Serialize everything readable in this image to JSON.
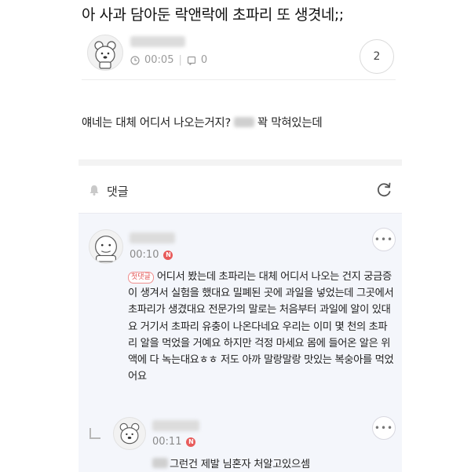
{
  "post": {
    "title": "아 사과 담아둔 락앤락에 초파리 또 생겻네;;",
    "time": "00:05",
    "comment_count": "0",
    "reply_count": "2",
    "body_before": "얘네는 대체 어디서 나오는거지?",
    "body_after": "꽉 막혀있는데"
  },
  "comments_header": {
    "label": "댓글"
  },
  "comments": [
    {
      "time": "00:10",
      "new_badge": "N",
      "tag": "첫댓글",
      "text": "어디서 봤는데 초파리는 대체 어디서 나오는 건지 궁금증이 생겨서 실험을 했대요 밀폐된 곳에 과일을 넣었는데 그곳에서 초파리가 생겼대요 전문가의 말로는 처음부터 과일에 알이 있대요 거기서 초파리 유충이 나온다네요 우리는 이미 몇 천의 초파리 알을 먹었을 거예요 하지만 걱정 마세요 몸에 들어온 알은 위액에 다 녹는대요ㅎㅎ 저도 아까 말랑말랑 맛있는 복숭아를 먹었어요"
    }
  ],
  "reply": {
    "time": "00:11",
    "new_badge": "N",
    "text": "그런건 제발 님혼자 처알고있으셈"
  },
  "icons": {
    "clock": "clock-icon",
    "comment": "comment-icon",
    "bell": "bell-icon",
    "refresh": "refresh-icon",
    "more": "more-icon",
    "reply_arrow": "reply-arrow-icon"
  },
  "colors": {
    "badge": "#e85b5b",
    "comments_background": "#f4f6fb"
  }
}
